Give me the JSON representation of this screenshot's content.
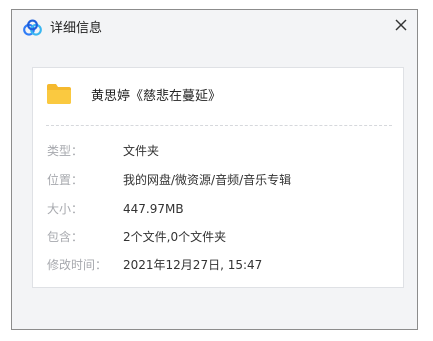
{
  "dialog": {
    "title": "详细信息",
    "close_icon": "close-icon",
    "logo_icon": "cloud-logo-icon"
  },
  "file": {
    "icon": "folder-icon",
    "folder_color": "#f7c744",
    "name": "黄思婷《慈悲在蔓延》"
  },
  "details": [
    {
      "label": "类型：",
      "value": "文件夹"
    },
    {
      "label": "位置：",
      "value": "我的网盘/微资源/音频/音乐专辑"
    },
    {
      "label": "大小：",
      "value": "447.97MB"
    },
    {
      "label": "包含：",
      "value": "2个文件,0个文件夹"
    },
    {
      "label": "修改时间：",
      "value": "2021年12月27日, 15:47"
    }
  ],
  "colors": {
    "background": "#f3f4f6",
    "label": "#a7a9ae",
    "value": "#333333",
    "logo_blue": "#2f7cf6"
  }
}
